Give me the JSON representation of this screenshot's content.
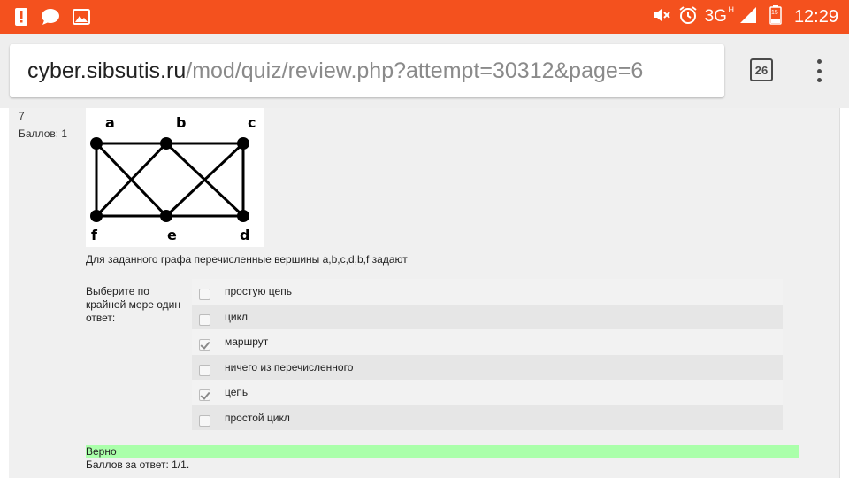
{
  "status_bar": {
    "time": "12:29",
    "network": "3G",
    "network_sup": "H",
    "battery_level": "15",
    "color": "#f4511e",
    "left_icons": [
      "alert-icon",
      "chat-icon",
      "image-icon"
    ],
    "right_icons": [
      "mute-icon",
      "alarm-icon",
      "signal-icon",
      "battery-icon"
    ]
  },
  "browser": {
    "url_host": "cyber.sibsutis.ru",
    "url_path": "/mod/quiz/review.php?attempt=30312&page=6",
    "tab_count": "26",
    "menu_icon": "more-vert-icon"
  },
  "question": {
    "number": "7",
    "grade": "Баллов: 1",
    "graph": {
      "vertices": [
        {
          "label": "a"
        },
        {
          "label": "b"
        },
        {
          "label": "c"
        },
        {
          "label": "f"
        },
        {
          "label": "e"
        },
        {
          "label": "d"
        }
      ],
      "edges": [
        [
          "a",
          "b"
        ],
        [
          "b",
          "c"
        ],
        [
          "a",
          "f"
        ],
        [
          "c",
          "d"
        ],
        [
          "f",
          "e"
        ],
        [
          "e",
          "d"
        ],
        [
          "a",
          "e"
        ],
        [
          "b",
          "f"
        ],
        [
          "b",
          "d"
        ],
        [
          "c",
          "e"
        ]
      ]
    },
    "text": "Для заданного графа перечисленные вершины a,b,c,d,b,f задают",
    "prompt": "Выберите по крайней мере один ответ:",
    "answers": [
      {
        "label": "простую цепь",
        "checked": false
      },
      {
        "label": "цикл",
        "checked": false
      },
      {
        "label": "маршрут",
        "checked": true
      },
      {
        "label": "ничего из перечисленного",
        "checked": false
      },
      {
        "label": "цепь",
        "checked": true
      },
      {
        "label": "простой цикл",
        "checked": false
      }
    ],
    "feedback": "Верно",
    "feedback_color": "#aaffaa",
    "mark": "Баллов за ответ: 1/1."
  }
}
